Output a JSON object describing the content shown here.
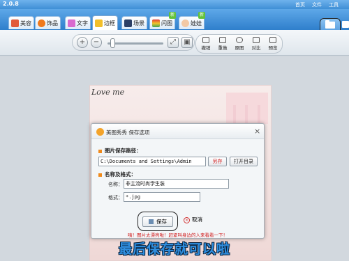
{
  "titlebar": {
    "version": "2.0.8",
    "menu": [
      "首页",
      "文件",
      "工具"
    ]
  },
  "tabs": [
    {
      "label": "美容",
      "icon": "beauty-icon"
    },
    {
      "label": "饰品",
      "icon": "heart-icon"
    },
    {
      "label": "文字",
      "icon": "text-icon"
    },
    {
      "label": "边框",
      "icon": "frame-icon",
      "active": true
    },
    {
      "label": "场景",
      "icon": "scene-icon"
    },
    {
      "label": "闪图",
      "icon": "flash-icon"
    },
    {
      "label": "娃娃",
      "icon": "doll-icon"
    }
  ],
  "open_button": {
    "label": "打开"
  },
  "save_button": {
    "label": "保存"
  },
  "toolbar": {
    "undo": "撤销",
    "redo": "重做",
    "original": "原图",
    "compare": "对比",
    "preview": "预览"
  },
  "photo": {
    "text": "Love me"
  },
  "dialog": {
    "title": "美图秀秀 保存选项",
    "close": "×",
    "path_section": "图片保存路径：",
    "path_value": "C:\\Documents and Settings\\Admin",
    "another_btn": "另存",
    "open_dir_btn": "打开目录",
    "name_section": "名称及格式：",
    "name_label": "名称：",
    "name_value": "非主流时尚学生装",
    "format_label": "格式：",
    "format_value": "*.jpg",
    "save_btn": "保存",
    "cancel_btn": "取消",
    "tip": "咦！图片太漂亮啦！赶紧叫身边的人来看看一下！"
  },
  "caption": "最后保存就可以啦",
  "colors": {
    "accent": "#3f8fd6",
    "caption": "#2f8fe0",
    "bullet": "#f08a1b",
    "warning": "#d11c1c"
  }
}
